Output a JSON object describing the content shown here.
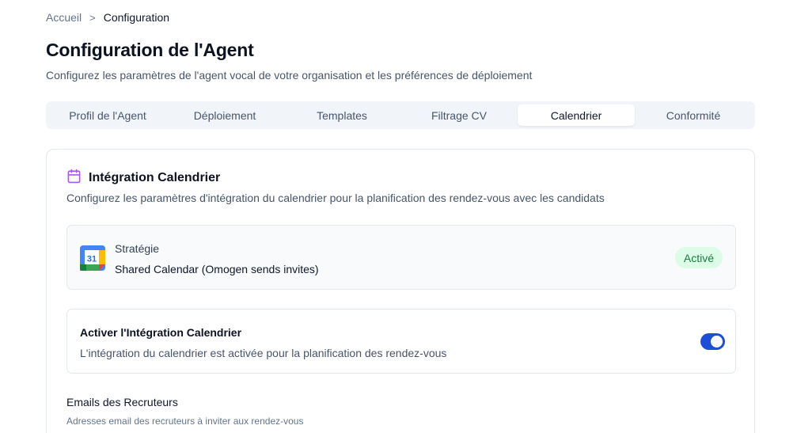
{
  "breadcrumb": {
    "home": "Accueil",
    "separator": ">",
    "current": "Configuration"
  },
  "page": {
    "title": "Configuration de l'Agent",
    "subtitle": "Configurez les paramètres de l'agent vocal de votre organisation et les préférences de déploiement"
  },
  "tabs": [
    {
      "label": "Profil de l'Agent",
      "active": false
    },
    {
      "label": "Déploiement",
      "active": false
    },
    {
      "label": "Templates",
      "active": false
    },
    {
      "label": "Filtrage CV",
      "active": false
    },
    {
      "label": "Calendrier",
      "active": true
    },
    {
      "label": "Conformité",
      "active": false
    }
  ],
  "calendar": {
    "title": "Intégration Calendrier",
    "title_icon": "calendar-icon",
    "description": "Configurez les paramètres d'intégration du calendrier pour la planification des rendez-vous avec les candidats",
    "strategy": {
      "icon": "google-calendar-icon",
      "icon_text": "31",
      "label": "Stratégie",
      "value": "Shared Calendar (Omogen sends invites)",
      "status": "Activé"
    },
    "integration_toggle": {
      "title": "Activer l'Intégration Calendrier",
      "description": "L'intégration du calendrier est activée pour la planification des rendez-vous",
      "enabled": true
    },
    "recruiter_emails": {
      "label": "Emails des Recruteurs",
      "help": "Adresses email des recruteurs à inviter aux rendez-vous"
    }
  },
  "colors": {
    "accent": "#1d4ed8",
    "calendar_icon": "#a855f7",
    "badge_bg": "#dcfce7",
    "badge_text": "#15803d"
  }
}
